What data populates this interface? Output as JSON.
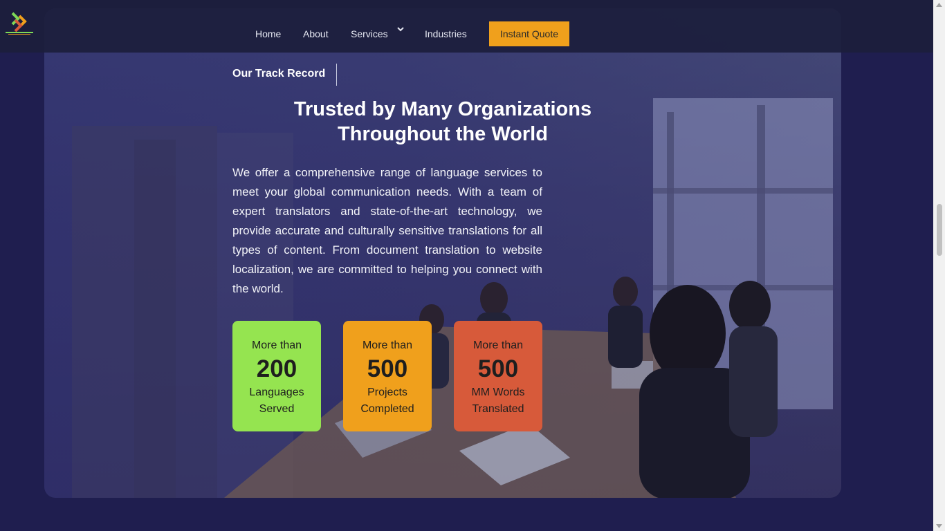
{
  "nav": {
    "logo_icon": "brand-chevrons-logo",
    "items": [
      "Home",
      "About",
      "Services",
      "Industries"
    ],
    "services_caret_icon": "chevron-down-icon",
    "cta": "Instant Quote",
    "cta_color": "#f0a01c"
  },
  "section": {
    "eyebrow": "Our Track Record",
    "title_line1": "Trusted by Many Organizations",
    "title_line2": "Throughout the World",
    "body": "We offer a comprehensive range of language services to meet your global communication needs. With a team of expert translators and state-of-the-art technology, we provide accurate and culturally sensitive translations for all types of content. From document translation to website localization, we are committed to helping you connect with the world.",
    "background_image": "office-meeting-photo"
  },
  "stats": [
    {
      "pre": "More than",
      "num": "200",
      "label1": "Languages",
      "label2": "Served",
      "color": "#95e450"
    },
    {
      "pre": "More than",
      "num": "500",
      "label1": "Projects",
      "label2": "Completed",
      "color": "#f0a01c"
    },
    {
      "pre": "More than",
      "num": "500",
      "label1": "MM Words",
      "label2": "Translated",
      "color": "#d75a3a"
    }
  ],
  "colors": {
    "page_bg": "#1f1e4f",
    "nav_bg": "#1c1e3c"
  }
}
